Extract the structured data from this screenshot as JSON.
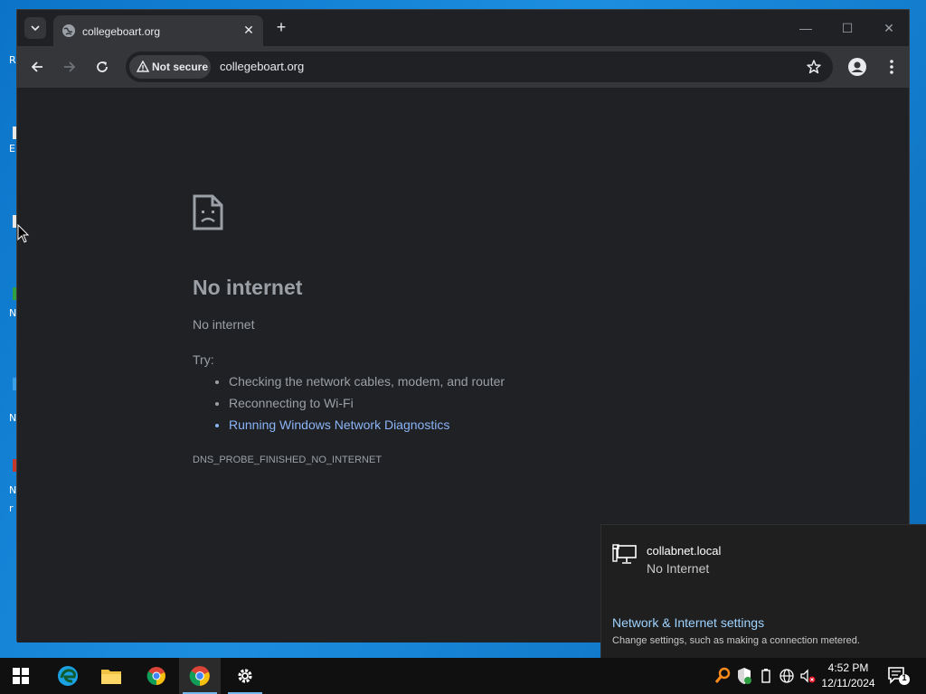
{
  "browser": {
    "tab_title": "collegeboart.org",
    "security_label": "Not secure",
    "url": "collegeboart.org"
  },
  "error_page": {
    "title": "No internet",
    "subtitle": "No internet",
    "try_label": "Try:",
    "suggestions": [
      "Checking the network cables, modem, and router",
      "Reconnecting to Wi-Fi",
      "Running Windows Network Diagnostics"
    ],
    "error_code": "DNS_PROBE_FINISHED_NO_INTERNET"
  },
  "network_flyout": {
    "network_name": "collabnet.local",
    "status": "No Internet",
    "settings_link": "Network & Internet settings",
    "settings_desc": "Change settings, such as making a connection metered."
  },
  "taskbar": {
    "time": "4:52 PM",
    "date": "12/11/2024",
    "notification_count": "1"
  },
  "colors": {
    "page_bg": "#202124",
    "link": "#8ab4f8",
    "desktop": "#0b74c9"
  }
}
